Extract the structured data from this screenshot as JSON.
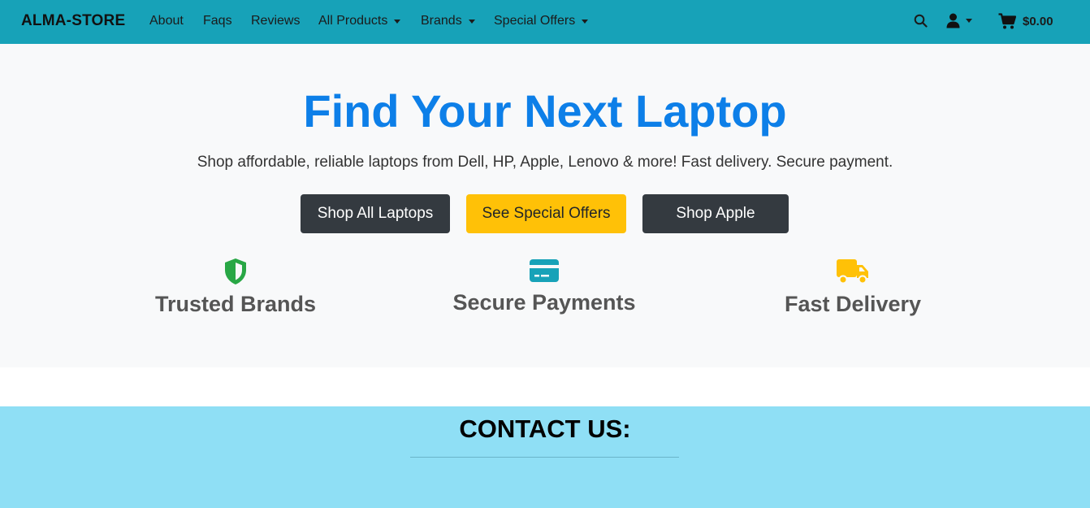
{
  "navbar": {
    "brand": "ALMA-STORE",
    "links": [
      {
        "label": "About",
        "dropdown": false
      },
      {
        "label": "Faqs",
        "dropdown": false
      },
      {
        "label": "Reviews",
        "dropdown": false
      },
      {
        "label": "All Products",
        "dropdown": true
      },
      {
        "label": "Brands",
        "dropdown": true
      },
      {
        "label": "Special Offers",
        "dropdown": true
      }
    ],
    "icons": {
      "search": "search-icon",
      "user": "user-icon",
      "cart": "cart-icon"
    },
    "cart_total": "$0.00"
  },
  "hero": {
    "title": "Find Your Next Laptop",
    "subtitle": "Shop affordable, reliable laptops from Dell, HP, Apple, Lenovo & more! Fast delivery. Secure payment.",
    "buttons": [
      {
        "label": "Shop All Laptops",
        "style": "dark"
      },
      {
        "label": "See Special Offers",
        "style": "warning"
      },
      {
        "label": "Shop Apple",
        "style": "dark"
      }
    ],
    "features": [
      {
        "label": "Trusted Brands",
        "icon": "shield-icon",
        "color": "#28a745"
      },
      {
        "label": "Secure Payments",
        "icon": "credit-card-icon",
        "color": "#17a2b8"
      },
      {
        "label": "Fast Delivery",
        "icon": "truck-icon",
        "color": "#ffc107"
      }
    ]
  },
  "contact": {
    "title": "CONTACT US:"
  },
  "colors": {
    "navbar": "#17a2b8",
    "hero_title": "#0d7fe8",
    "contact_bg": "#8fdff5"
  }
}
